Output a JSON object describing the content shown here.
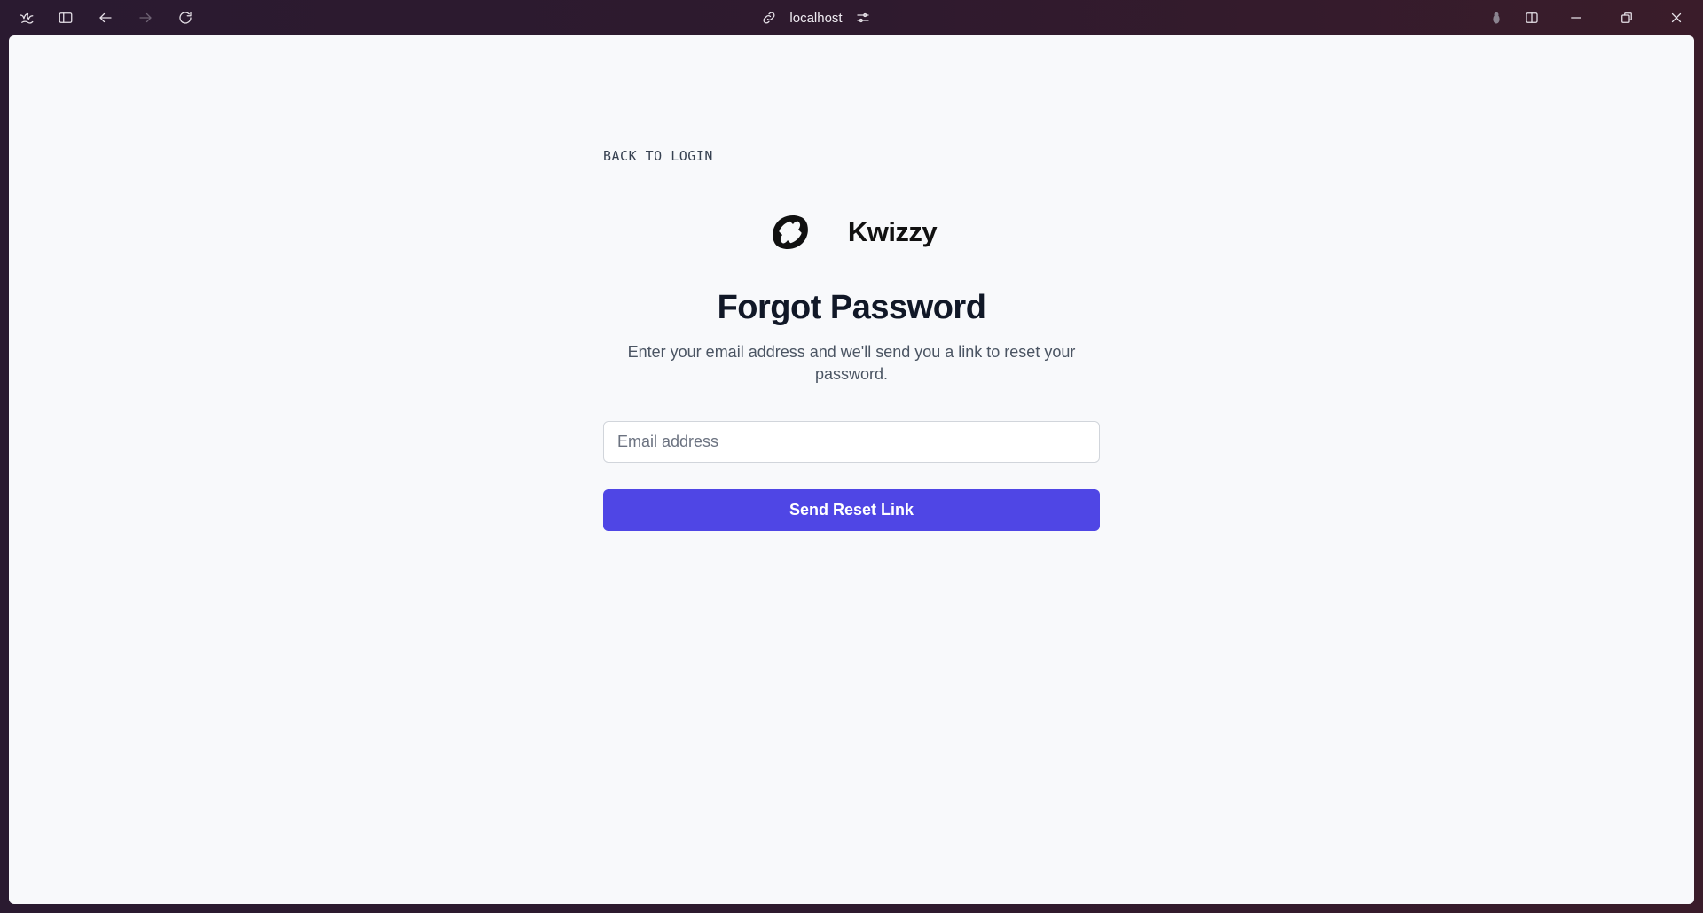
{
  "browser": {
    "url": "localhost",
    "icons": {
      "app": "browser-logo-icon",
      "sidebar": "sidebar-toggle-icon",
      "back": "arrow-left-icon",
      "forward": "arrow-right-icon",
      "reload": "reload-icon",
      "link": "link-icon",
      "site_settings": "sliders-icon",
      "extension": "extension-icon",
      "split_view": "split-view-icon",
      "minimize": "minimize-icon",
      "restore": "restore-icon",
      "close": "close-icon"
    }
  },
  "page": {
    "back_link": "BACK TO LOGIN",
    "brand_name": "Kwizzy",
    "title": "Forgot Password",
    "subtitle": "Enter your email address and we'll send you a link to reset your password.",
    "email_placeholder": "Email address",
    "email_value": "",
    "submit_label": "Send Reset Link"
  },
  "colors": {
    "accent": "#4f46e5",
    "page_background": "#f8f9fb",
    "heading": "#111827",
    "muted_text": "#4b5563"
  }
}
